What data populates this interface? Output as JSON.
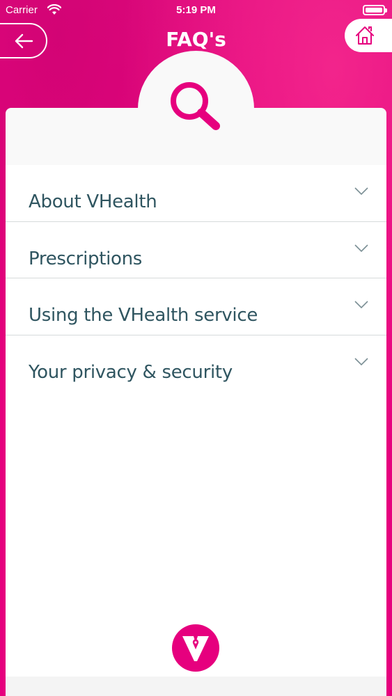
{
  "status_bar": {
    "carrier": "Carrier",
    "time": "5:19 PM"
  },
  "header": {
    "title": "FAQ's",
    "back_icon": "arrow-left-icon",
    "home_icon": "home-icon"
  },
  "faq": {
    "items": [
      {
        "label": "About VHealth"
      },
      {
        "label": "Prescriptions"
      },
      {
        "label": "Using the VHealth service"
      },
      {
        "label": "Your privacy & security"
      }
    ]
  },
  "colors": {
    "brand": "#e6007e",
    "text": "#2f5560",
    "divider": "#d6dadb"
  }
}
